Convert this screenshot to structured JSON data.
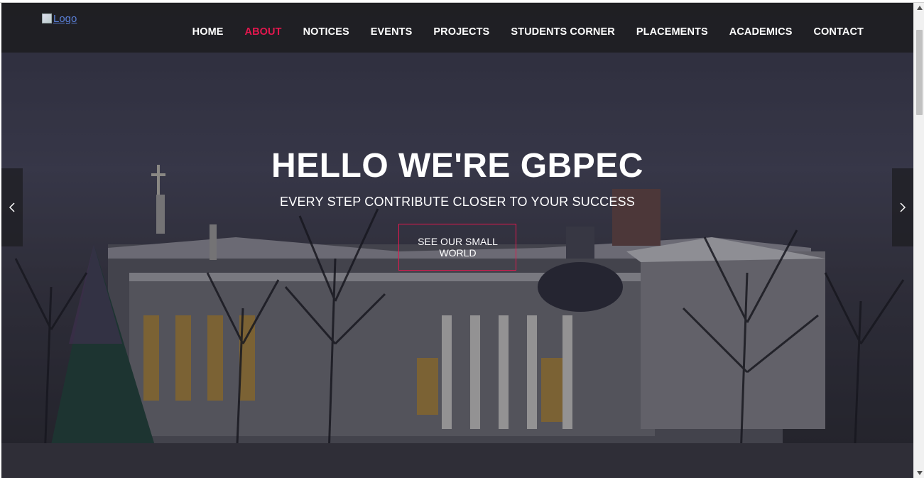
{
  "logo": {
    "alt_text": "Logo"
  },
  "nav": {
    "items": [
      {
        "label": "HOME",
        "active": false
      },
      {
        "label": "ABOUT",
        "active": true
      },
      {
        "label": "NOTICES",
        "active": false
      },
      {
        "label": "EVENTS",
        "active": false
      },
      {
        "label": "PROJECTS",
        "active": false
      },
      {
        "label": "STUDENTS CORNER",
        "active": false
      },
      {
        "label": "PLACEMENTS",
        "active": false
      },
      {
        "label": "ACADEMICS",
        "active": false
      },
      {
        "label": "CONTACT",
        "active": false
      }
    ],
    "active_color": "#e3174e"
  },
  "hero": {
    "title": "HELLO WE'RE GBPEC",
    "subtitle": "EVERY STEP CONTRIBUTE CLOSER TO YOUR SUCCESS",
    "cta_label": "SEE OUR SMALL WORLD",
    "accent_color": "#e3174e"
  },
  "slider": {
    "prev_icon": "chevron-left-icon",
    "next_icon": "chevron-right-icon"
  },
  "scrollbar": {
    "up_icon": "triangle-up-icon",
    "down_icon": "triangle-down-icon"
  }
}
